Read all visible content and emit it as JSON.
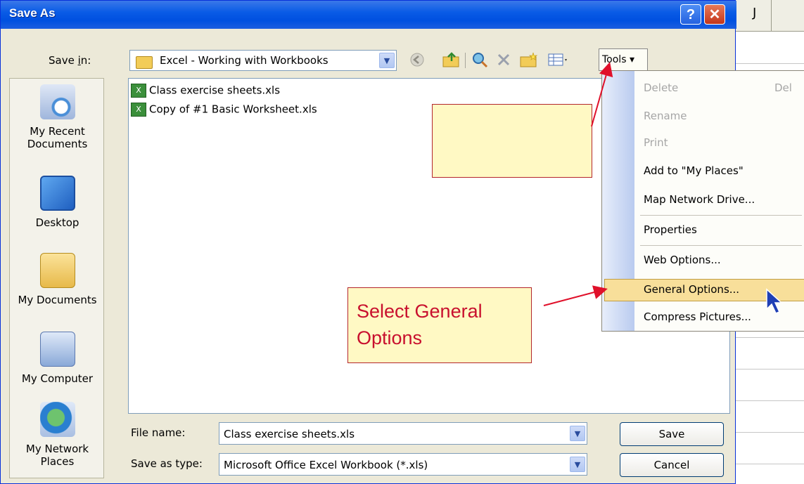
{
  "dialog": {
    "title": "Save As",
    "help_glyph": "?",
    "close_glyph": "✕"
  },
  "save_in": {
    "label_prefix": "Save ",
    "label_underlined": "i",
    "label_suffix": "n:",
    "value": "Excel - Working with Workbooks"
  },
  "toolbar": {
    "tools_label": "Tools ▾",
    "icons": [
      "back-icon",
      "up-folder-icon",
      "search-web-icon",
      "delete-icon",
      "new-folder-icon",
      "views-icon"
    ]
  },
  "places": [
    {
      "label": "My Recent Documents",
      "icon": "recent-documents-icon"
    },
    {
      "label": "Desktop",
      "icon": "desktop-icon"
    },
    {
      "label": "My Documents",
      "icon": "my-documents-icon"
    },
    {
      "label": "My Computer",
      "icon": "my-computer-icon"
    },
    {
      "label": "My Network Places",
      "icon": "network-places-icon"
    }
  ],
  "files": [
    {
      "name": "Class exercise sheets.xls"
    },
    {
      "name": "Copy of #1 Basic Worksheet.xls"
    }
  ],
  "file_name": {
    "label": "File name:",
    "value": "Class exercise sheets.xls"
  },
  "save_as_type": {
    "label": "Save as type:",
    "value": "Microsoft Office Excel Workbook (*.xls)"
  },
  "buttons": {
    "save": "Save",
    "cancel": "Cancel"
  },
  "tools_menu": {
    "items": [
      {
        "label": "Delete",
        "shortcut": "Del",
        "enabled": false
      },
      {
        "label": "Rename",
        "enabled": false
      },
      {
        "label": "Print",
        "enabled": false
      },
      {
        "label": "Add to \"My Places\"",
        "enabled": true
      },
      {
        "label": "Map Network Drive...",
        "enabled": true
      },
      {
        "label": "Properties",
        "enabled": true
      },
      {
        "label": "Web Options...",
        "enabled": true
      },
      {
        "label": "General Options...",
        "enabled": true,
        "highlighted": true
      },
      {
        "label": "Compress Pictures...",
        "enabled": true
      }
    ]
  },
  "callout": {
    "text": "Select General Options"
  },
  "sheet": {
    "column": "J"
  },
  "colors": {
    "titlebar": "#0a5ce6",
    "callout_text": "#c8102e",
    "highlight": "#f8df9a"
  }
}
